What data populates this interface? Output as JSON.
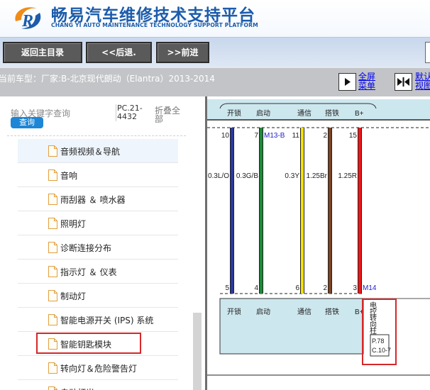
{
  "header": {
    "title_cn": "畅易汽车维修技术支持平台",
    "title_en": "CHANG YI AUTO MAINTENANCE TECHNOLOGY SUPPORT PLATFORM",
    "logo_icon": "swirl-r-logo-icon"
  },
  "nav": {
    "home_label": "返回主目录",
    "back_label": "<<后退.",
    "forward_label": ">>前进"
  },
  "vehicle": {
    "text": "当前车型：厂家:B-北京现代朗动（Elantra）2013-2014",
    "fullscreen_label_line1": "全屏",
    "fullscreen_label_line2": "菜单",
    "default_label_line1": "默认",
    "default_label_line2": "视图"
  },
  "sidebar": {
    "search_placeholder": "输入关键字查询",
    "query_button": "查询",
    "pc_code_line1": "PC.21-",
    "pc_code_line2": "4432",
    "collapse_line1": "折叠全",
    "collapse_line2": "部",
    "items": [
      {
        "label": "音频视频＆导航"
      },
      {
        "label": "音响"
      },
      {
        "label": "雨刮器 ＆ 喷水器"
      },
      {
        "label": "照明灯"
      },
      {
        "label": "诊断连接分布"
      },
      {
        "label": "指示灯 ＆ 仪表"
      },
      {
        "label": "制动灯"
      },
      {
        "label": "智能电源开关 (IPS) 系统"
      },
      {
        "label": "智能钥匙模块"
      },
      {
        "label": "转向灯＆危险警告灯"
      },
      {
        "label": "自动灯光"
      }
    ],
    "highlight_color": "#d62828"
  },
  "diagram": {
    "top_labels": [
      "开锁",
      "启动",
      "通信",
      "搭铁",
      "B+"
    ],
    "top_pins": [
      "10",
      "7",
      "11",
      "2",
      "15"
    ],
    "top_connector": "M13-B",
    "wire_specs": [
      "0.3L/O",
      "0.3G/B",
      "0.3Y",
      "1.25Br",
      "1.25R"
    ],
    "bottom_pins": [
      "5",
      "4",
      "6",
      "2",
      "3"
    ],
    "bottom_connector": "M14",
    "bottom_labels": [
      "开锁",
      "启动",
      "通信",
      "搭铁",
      "B+"
    ],
    "module_name_chars": [
      "电",
      "控",
      "转",
      "向",
      "柱",
      "锁"
    ],
    "page_ref_line1": "P.78",
    "page_ref_line2": "C.10-7",
    "wire_colors": [
      "#2a3aa0",
      "#1e8a3a",
      "#f2e100",
      "#7a4424",
      "#e81818"
    ],
    "module_fill": "#cde7ee",
    "connector_text_color": "#2222cc"
  }
}
